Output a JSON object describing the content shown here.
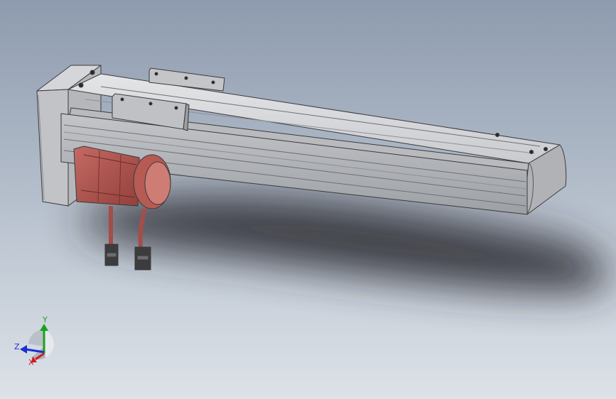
{
  "viewport": {
    "background_top": "#8e9bae",
    "background_bottom": "#dde2e8"
  },
  "model": {
    "actuator_color": "#c7c9cc",
    "motor_color": "#b3514c",
    "edge_color": "#3a3a3a"
  },
  "triad": {
    "x_label": "X",
    "y_label": "Y",
    "z_label": "Z",
    "x_color": "#d21a1a",
    "y_color": "#1aa31a",
    "z_color": "#1a2fd2"
  }
}
